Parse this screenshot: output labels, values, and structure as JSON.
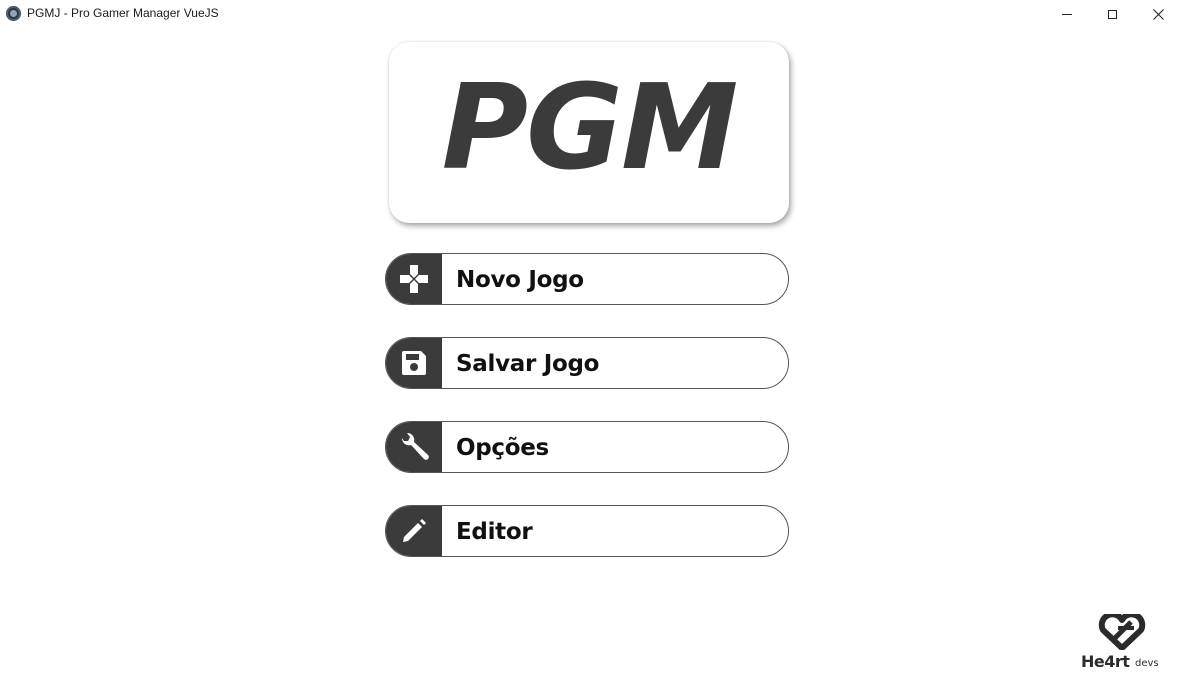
{
  "window": {
    "title": "PGMJ - Pro Gamer Manager VueJS",
    "app_icon": "electron-icon"
  },
  "logo": {
    "text": "PGM"
  },
  "menu": {
    "items": [
      {
        "label": "Novo Jogo",
        "icon": "gamepad-icon"
      },
      {
        "label": "Salvar Jogo",
        "icon": "floppy-disk-icon"
      },
      {
        "label": "Opções",
        "icon": "wrench-icon"
      },
      {
        "label": "Editor",
        "icon": "pencil-icon"
      }
    ]
  },
  "brand": {
    "name": "He4rt",
    "suffix": "devs"
  },
  "colors": {
    "accent_dark": "#3b3b3b",
    "background": "#ffffff",
    "button_border": "#555555"
  }
}
